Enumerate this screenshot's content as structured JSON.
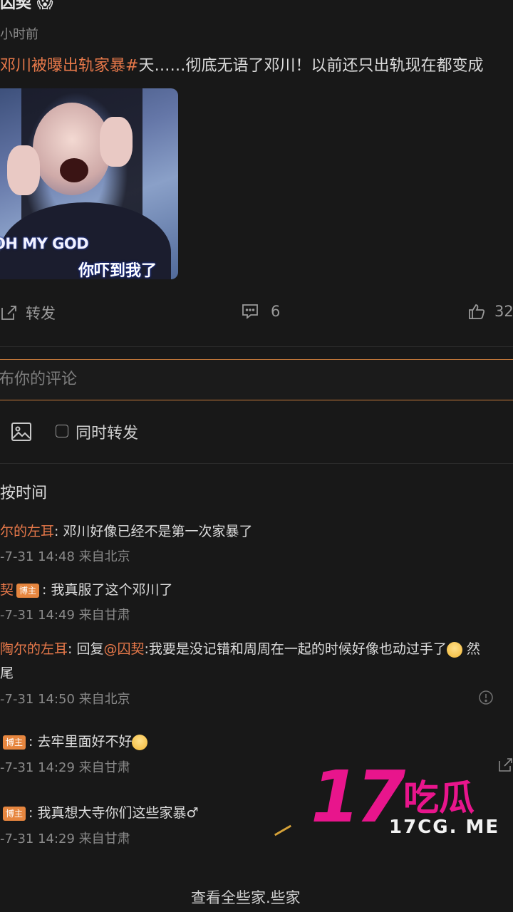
{
  "post": {
    "author": "囚契 😱",
    "time": "小时前",
    "hashtag": "邓川被曝出轨家暴#",
    "text": "天……彻底无语了邓川！以前还只出轨现在都变成",
    "image": {
      "caption_en": "OH MY GOD",
      "caption_cn": "你吓到我了"
    },
    "actions": {
      "repost_label": "转发",
      "comment_count": "6",
      "like_count": "32"
    }
  },
  "composer": {
    "placeholder": "布你的评论",
    "repost_checkbox_label": "同时转发"
  },
  "sort": {
    "label": "按时间"
  },
  "comments": [
    {
      "user": "尔的左耳",
      "text": ": 邓川好像已经不是第一次家暴了",
      "meta": "-7-31 14:48 来自北京"
    },
    {
      "user": "契",
      "badge": "博主",
      "text": ": 我真服了这个邓川了",
      "meta": "-7-31 14:49 来自甘肃"
    },
    {
      "user": "陶尔的左耳",
      "text_prefix": ": 回复",
      "mention": "@囚契",
      "text": ":我要是没记错和周周在一起的时候好像也动过手了",
      "text_tail": " 然",
      "text_line2": "尾",
      "meta": "-7-31 14:50 来自北京"
    },
    {
      "user": "",
      "badge": "博主",
      "text": ": 去牢里面好不好",
      "meta": "-7-31 14:29 来自甘肃"
    },
    {
      "user": "",
      "badge": "博主",
      "text": ": 我真想大寺你们这些家暴♂",
      "meta": "-7-31 14:29 来自甘肃"
    }
  ],
  "footer": {
    "view_all": "查看全些家.些家"
  },
  "watermark": {
    "number": "17",
    "cn": "吃瓜",
    "url": "17CG. ME"
  },
  "colors": {
    "accent": "#e8794a",
    "badge": "#e6863f",
    "watermark": "#e8158c",
    "background": "#181818"
  }
}
